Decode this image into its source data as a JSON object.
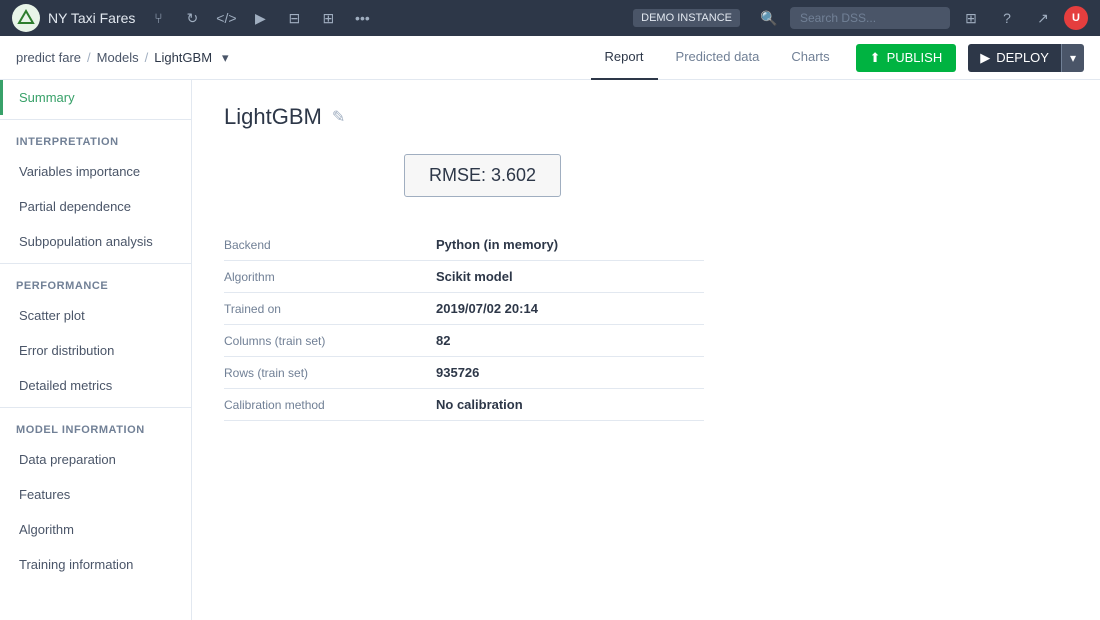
{
  "app": {
    "logo_symbol": "✦",
    "title": "NY Taxi Fares",
    "demo_badge": "DEMO INSTANCE"
  },
  "top_nav": {
    "icons": [
      "◁▷",
      "</>",
      "▶",
      "⊟",
      "⊞",
      "•••"
    ],
    "search_placeholder": "Search DSS...",
    "grid_icon": "⊞",
    "help_icon": "?",
    "trend_icon": "↗"
  },
  "breadcrumb": {
    "project": "predict fare",
    "section": "Models",
    "current": "LightGBM"
  },
  "second_nav_tabs": [
    {
      "label": "Report",
      "active": true
    },
    {
      "label": "Predicted data",
      "active": false
    },
    {
      "label": "Charts",
      "active": false
    }
  ],
  "buttons": {
    "publish": "PUBLISH",
    "deploy": "DEPLOY"
  },
  "sidebar": {
    "summary_label": "Summary",
    "interpretation_header": "INTERPRETATION",
    "interpretation_items": [
      "Variables importance",
      "Partial dependence",
      "Subpopulation analysis"
    ],
    "performance_header": "PERFORMANCE",
    "performance_items": [
      "Scatter plot",
      "Error distribution",
      "Detailed metrics"
    ],
    "model_info_header": "MODEL INFORMATION",
    "model_info_items": [
      "Data preparation",
      "Features",
      "Algorithm",
      "Training information"
    ]
  },
  "main": {
    "model_name": "LightGBM",
    "rmse_label": "RMSE: 3.602",
    "table_rows": [
      {
        "label": "Backend",
        "value": "Python (in memory)"
      },
      {
        "label": "Algorithm",
        "value": "Scikit model"
      },
      {
        "label": "Trained on",
        "value": "2019/07/02 20:14"
      },
      {
        "label": "Columns (train set)",
        "value": "82"
      },
      {
        "label": "Rows (train set)",
        "value": "935726"
      },
      {
        "label": "Calibration method",
        "value": "No calibration"
      }
    ]
  }
}
